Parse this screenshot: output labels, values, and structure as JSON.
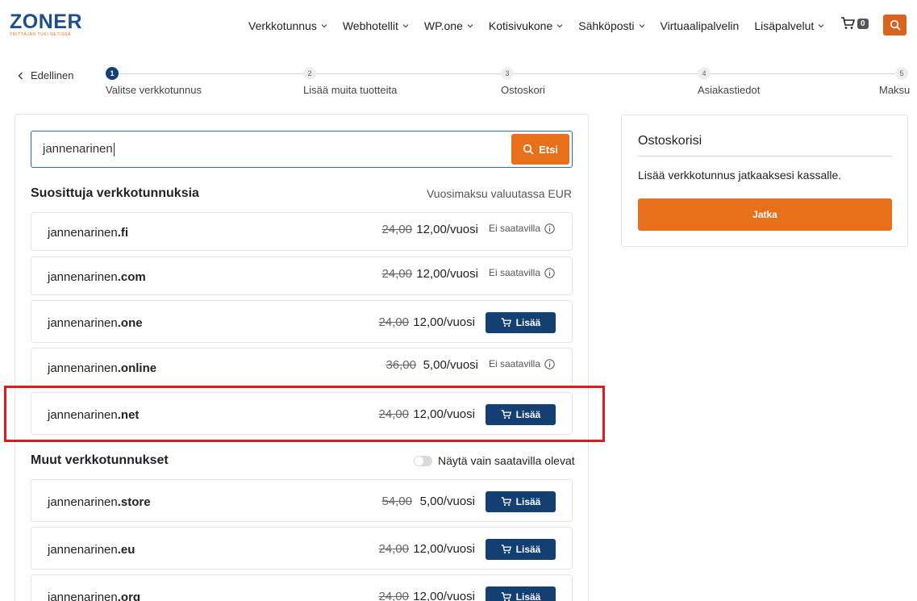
{
  "header": {
    "logo": "ZONER",
    "logo_tagline": "YRITTÄJÄN TUKI NETISSÄ",
    "nav": [
      {
        "label": "Verkkotunnus",
        "dropdown": true
      },
      {
        "label": "Webhotellit",
        "dropdown": true
      },
      {
        "label": "WP.one",
        "dropdown": true
      },
      {
        "label": "Kotisivukone",
        "dropdown": true
      },
      {
        "label": "Sähköposti",
        "dropdown": true
      },
      {
        "label": "Virtuaalipalvelin",
        "dropdown": false
      },
      {
        "label": "Lisäpalvelut",
        "dropdown": true
      }
    ],
    "cart_count": "0",
    "colors": {
      "brand": "#1f4e8c",
      "accent": "#e8701a",
      "button_primary": "#133f73"
    }
  },
  "stepper": {
    "back_label": "Edellinen",
    "steps": [
      {
        "num": "1",
        "label": "Valitse verkkotunnus",
        "active": true
      },
      {
        "num": "2",
        "label": "Lisää muita tuotteita",
        "active": false
      },
      {
        "num": "3",
        "label": "Ostoskori",
        "active": false
      },
      {
        "num": "4",
        "label": "Asiakastiedot",
        "active": false
      },
      {
        "num": "5",
        "label": "Maksu",
        "active": false
      }
    ]
  },
  "search": {
    "value": "jannenarinen",
    "button_label": "Etsi"
  },
  "suggested": {
    "title": "Suosittuja verkkotunnuksia",
    "note": "Vuosimaksu valuutassa EUR",
    "rows": [
      {
        "name": "jannenarinen",
        "tld": ".fi",
        "old_price": "24,00",
        "price": "12,00/vuosi",
        "available": false,
        "status": "Ei saatavilla"
      },
      {
        "name": "jannenarinen",
        "tld": ".com",
        "old_price": "24,00",
        "price": "12,00/vuosi",
        "available": false,
        "status": "Ei saatavilla"
      },
      {
        "name": "jannenarinen",
        "tld": ".one",
        "old_price": "24,00",
        "price": "12,00/vuosi",
        "available": true,
        "button": "Lisää"
      },
      {
        "name": "jannenarinen",
        "tld": ".online",
        "old_price": "36,00",
        "price": "5,00/vuosi",
        "available": false,
        "status": "Ei saatavilla"
      },
      {
        "name": "jannenarinen",
        "tld": ".net",
        "old_price": "24,00",
        "price": "12,00/vuosi",
        "available": true,
        "button": "Lisää"
      }
    ]
  },
  "other": {
    "title": "Muut verkkotunnukset",
    "toggle_label": "Näytä vain saatavilla olevat",
    "rows": [
      {
        "name": "jannenarinen",
        "tld": ".store",
        "old_price": "54,00",
        "price": "5,00/vuosi",
        "available": true,
        "button": "Lisää"
      },
      {
        "name": "jannenarinen",
        "tld": ".eu",
        "old_price": "24,00",
        "price": "12,00/vuosi",
        "available": true,
        "button": "Lisää"
      },
      {
        "name": "jannenarinen",
        "tld": ".org",
        "old_price": "24,00",
        "price": "12,00/vuosi",
        "available": true,
        "button": "Lisää"
      }
    ]
  },
  "cart": {
    "title": "Ostoskorisi",
    "text": "Lisää verkkotunnus jatkaaksesi kassalle.",
    "button": "Jatka"
  }
}
